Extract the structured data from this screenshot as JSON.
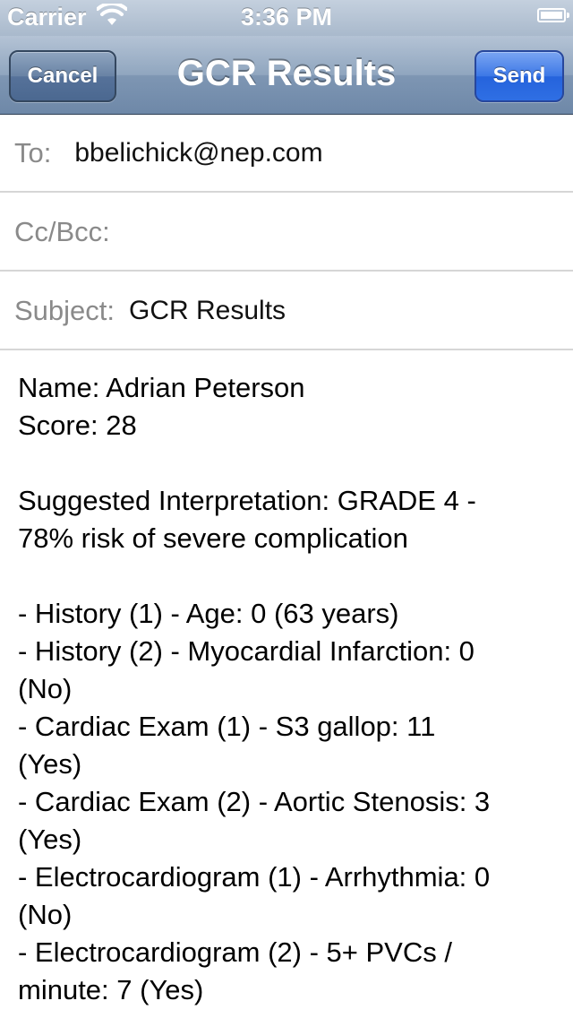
{
  "status_bar": {
    "carrier": "Carrier",
    "wifi_icon": "wifi-icon",
    "time": "3:36 PM",
    "battery_icon": "battery-icon"
  },
  "nav": {
    "title": "GCR Results",
    "cancel_label": "Cancel",
    "send_label": "Send"
  },
  "fields": {
    "to_label": "To:",
    "to_value": "bbelichick@nep.com",
    "cc_label": "Cc/Bcc:",
    "cc_value": "",
    "subject_label": "Subject:",
    "subject_value": "GCR Results"
  },
  "body": {
    "lines": [
      "Name: Adrian Peterson",
      "Score: 28",
      "",
      "Suggested Interpretation: GRADE 4 -",
      "78% risk of severe complication",
      "",
      "- History (1) - Age: 0 (63 years)",
      "- History (2) - Myocardial Infarction: 0",
      "(No)",
      "- Cardiac Exam (1) - S3 gallop: 11",
      "(Yes)",
      "- Cardiac Exam (2) - Aortic Stenosis: 3",
      "(Yes)",
      "- Electrocardiogram (1) - Arrhythmia: 0",
      "(No)",
      "- Electrocardiogram (2) - 5+ PVCs /",
      "minute: 7 (Yes)"
    ]
  },
  "colors": {
    "nav_gradient_top": "#b4c3d5",
    "nav_gradient_bottom": "#6e88a8",
    "send_button": "#2f6fe4",
    "field_label": "#8a8a8a",
    "separator": "#d6d6d6"
  }
}
